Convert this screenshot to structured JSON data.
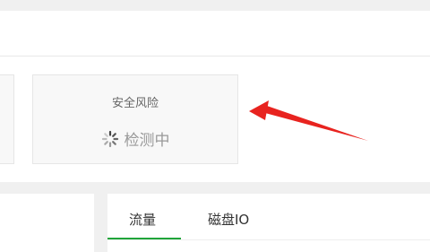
{
  "risk_card": {
    "title": "安全风险",
    "status": "检测中",
    "status_icon": "loading-spinner-icon"
  },
  "tabs": [
    {
      "label": "流量",
      "active": true
    },
    {
      "label": "磁盘IO",
      "active": false
    }
  ],
  "colors": {
    "accent_green": "#20a53a",
    "annotation_red": "#e8231f",
    "card_bg": "#f8f8f8",
    "page_bg": "#f0f0f0"
  }
}
